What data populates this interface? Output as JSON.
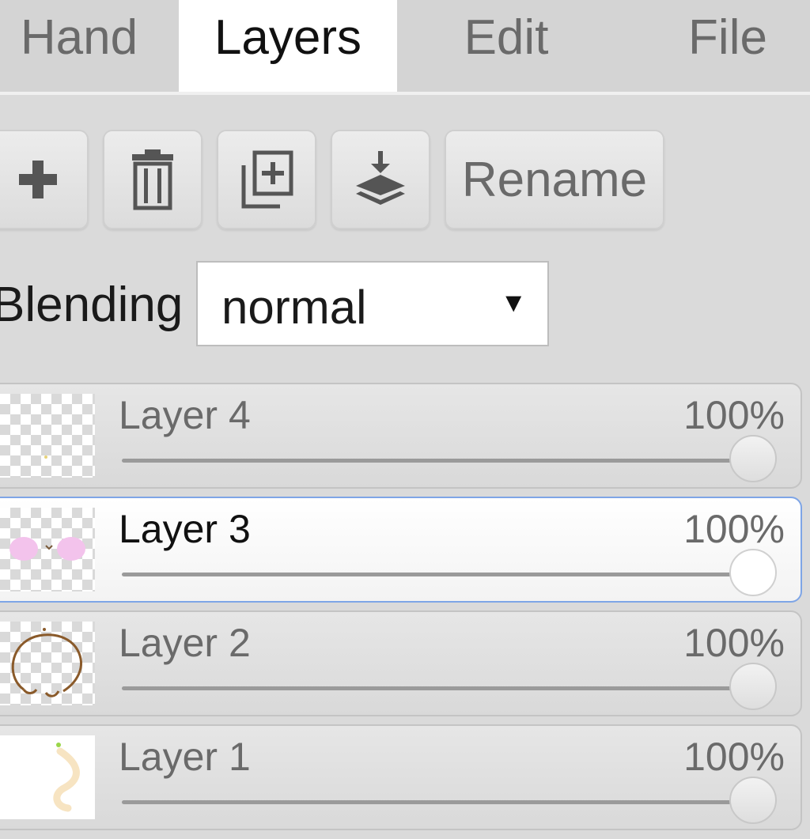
{
  "tabs": [
    {
      "label": "Hand"
    },
    {
      "label": "Layers"
    },
    {
      "label": "Edit"
    },
    {
      "label": "File"
    }
  ],
  "active_tab": "Layers",
  "toolbar": {
    "add_icon": "plus-icon",
    "delete_icon": "trash-icon",
    "duplicate_icon": "duplicate-icon",
    "merge_icon": "merge-down-icon",
    "rename_label": "Rename"
  },
  "blending": {
    "label": "Blending",
    "value": "normal",
    "arrow": "▼"
  },
  "layers": [
    {
      "name": "Layer 4",
      "opacity_text": "100%",
      "opacity": 1.0,
      "selected": false
    },
    {
      "name": "Layer 3",
      "opacity_text": "100%",
      "opacity": 1.0,
      "selected": true
    },
    {
      "name": "Layer 2",
      "opacity_text": "100%",
      "opacity": 1.0,
      "selected": false
    },
    {
      "name": "Layer 1",
      "opacity_text": "100%",
      "opacity": 1.0,
      "selected": false
    }
  ],
  "colors": {
    "selected_border": "#7ea5e6",
    "panel_bg": "#dadada",
    "tab_active_bg": "#ffffff"
  }
}
